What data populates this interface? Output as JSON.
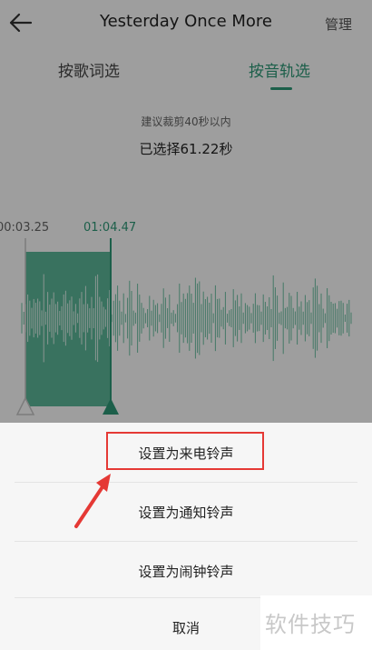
{
  "header": {
    "back_icon": "arrow-left-icon",
    "title": "Yesterday Once More",
    "manage_label": "管理"
  },
  "tabs": [
    {
      "label": "按歌词选",
      "active": false
    },
    {
      "label": "按音轨选",
      "active": true
    }
  ],
  "trim": {
    "hint": "建议裁剪40秒以内",
    "selected_text": "已选择61.22秒",
    "start_time": "00:03.25",
    "end_time": "01:04.47"
  },
  "sheet": {
    "items": [
      {
        "label": "设置为来电铃声",
        "highlighted": true
      },
      {
        "label": "设置为通知铃声",
        "highlighted": false
      },
      {
        "label": "设置为闹钟铃声",
        "highlighted": false
      }
    ],
    "cancel_label": "取消"
  },
  "watermark": "软件技巧",
  "colors": {
    "accent": "#2e9a78",
    "highlight": "#e53935",
    "overlay": "rgba(0,0,0,0.38)"
  }
}
